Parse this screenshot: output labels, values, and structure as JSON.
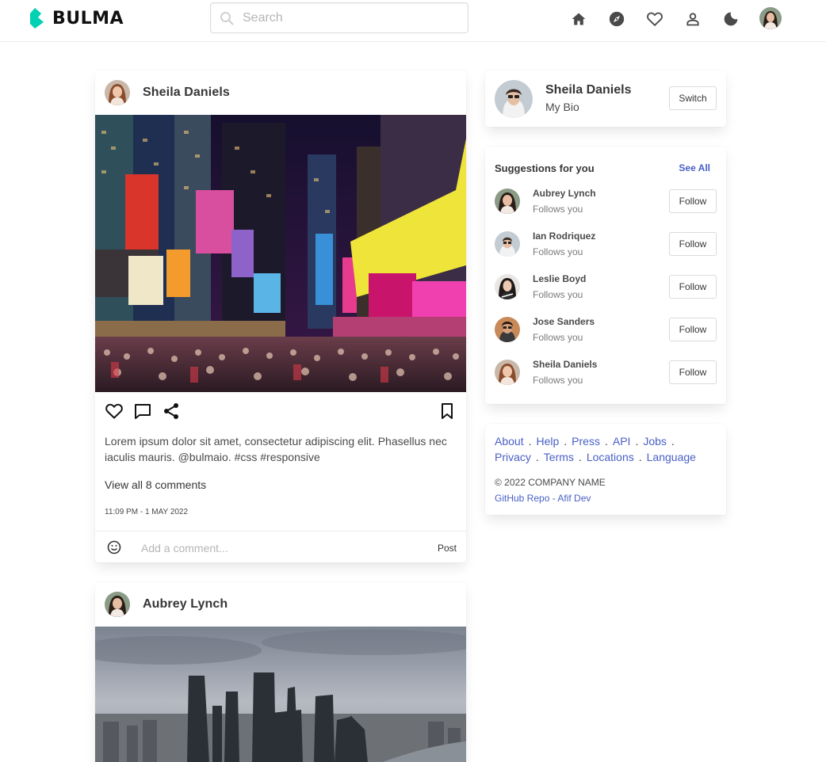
{
  "brand": {
    "name": "BULMA"
  },
  "search": {
    "placeholder": "Search"
  },
  "nav": {
    "icons": [
      "home-icon",
      "compass-icon",
      "heart-icon",
      "user-icon",
      "moon-icon",
      "avatar"
    ]
  },
  "posts": [
    {
      "author": "Sheila Daniels",
      "caption": "Lorem ipsum dolor sit amet, consectetur adipiscing elit. Phasellus nec iaculis mauris. @bulmaio. #css #responsive",
      "view_comments": "View all 8 comments",
      "timestamp": "11:09 PM - 1 MAY 2022",
      "comment_placeholder": "Add a comment...",
      "post_label": "Post"
    },
    {
      "author": "Aubrey Lynch"
    }
  ],
  "profile": {
    "name": "Sheila Daniels",
    "bio": "My Bio",
    "switch_label": "Switch"
  },
  "suggestions": {
    "title": "Suggestions for you",
    "see_all": "See All",
    "follow_label": "Follow",
    "items": [
      {
        "name": "Aubrey Lynch",
        "sub": "Follows you"
      },
      {
        "name": "Ian Rodriquez",
        "sub": "Follows you"
      },
      {
        "name": "Leslie Boyd",
        "sub": "Follows you"
      },
      {
        "name": "Jose Sanders",
        "sub": "Follows you"
      },
      {
        "name": "Sheila Daniels",
        "sub": "Follows you"
      }
    ]
  },
  "footer": {
    "links": [
      "About",
      "Help",
      "Press",
      "API",
      "Jobs",
      "Privacy",
      "Terms",
      "Locations",
      "Language"
    ],
    "copyright": "© 2022 COMPANY NAME",
    "credit": "GitHub Repo - Afif Dev"
  },
  "colors": {
    "brand_accent": "#00d1b2",
    "link": "#485fc7",
    "text": "#363636",
    "border": "#dbdbdb"
  }
}
